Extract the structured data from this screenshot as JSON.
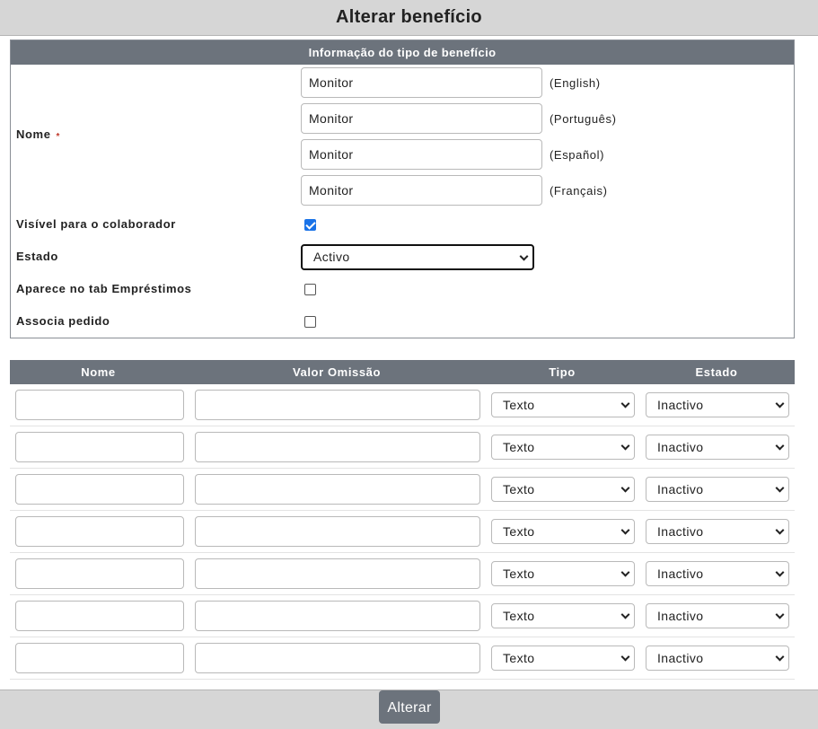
{
  "page": {
    "title": "Alterar benefício"
  },
  "info": {
    "header": "Informação do tipo de benefício",
    "nome_label": "Nome",
    "required_mark": "*",
    "names": [
      {
        "value": "Monitor",
        "lang": "(English)"
      },
      {
        "value": "Monitor",
        "lang": "(Português)"
      },
      {
        "value": "Monitor",
        "lang": "(Español)"
      },
      {
        "value": "Monitor",
        "lang": "(Français)"
      }
    ],
    "visivel_label": "Visível para o colaborador",
    "visivel_checked": true,
    "estado_label": "Estado",
    "estado_value": "Activo",
    "aparece_label": "Aparece no tab Empréstimos",
    "aparece_checked": false,
    "associa_label": "Associa pedido",
    "associa_checked": false
  },
  "grid": {
    "headers": {
      "nome": "Nome",
      "valor": "Valor Omissão",
      "tipo": "Tipo",
      "estado": "Estado"
    },
    "rows": [
      {
        "nome": "",
        "valor": "",
        "tipo": "Texto",
        "estado": "Inactivo"
      },
      {
        "nome": "",
        "valor": "",
        "tipo": "Texto",
        "estado": "Inactivo"
      },
      {
        "nome": "",
        "valor": "",
        "tipo": "Texto",
        "estado": "Inactivo"
      },
      {
        "nome": "",
        "valor": "",
        "tipo": "Texto",
        "estado": "Inactivo"
      },
      {
        "nome": "",
        "valor": "",
        "tipo": "Texto",
        "estado": "Inactivo"
      },
      {
        "nome": "",
        "valor": "",
        "tipo": "Texto",
        "estado": "Inactivo"
      },
      {
        "nome": "",
        "valor": "",
        "tipo": "Texto",
        "estado": "Inactivo"
      }
    ]
  },
  "footer": {
    "submit_label": "Alterar"
  },
  "colors": {
    "header_bg": "#6c737c",
    "bar_bg": "#d6d6d6",
    "checkbox_accent": "#1a73e8"
  }
}
